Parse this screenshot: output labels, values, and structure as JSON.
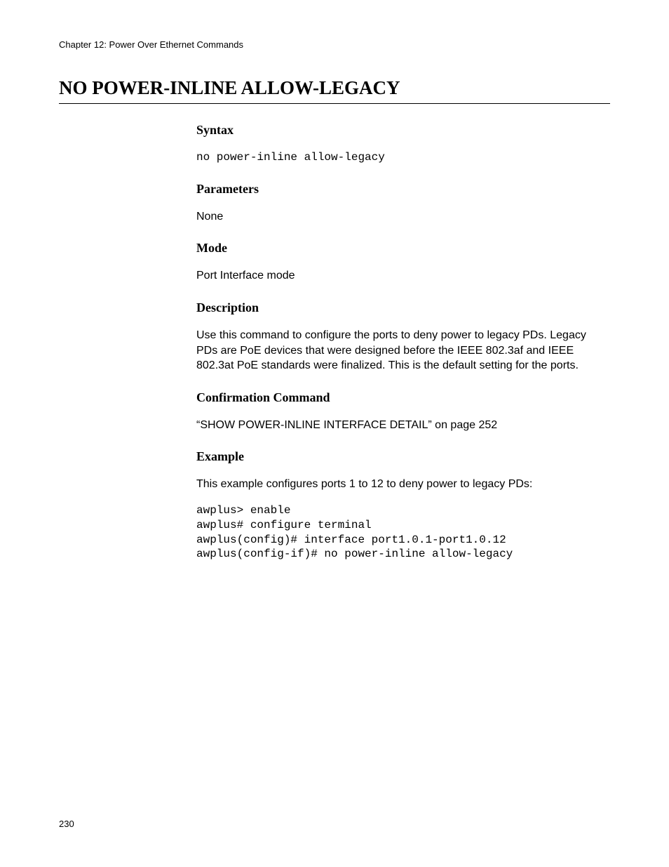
{
  "header": "Chapter 12: Power Over Ethernet Commands",
  "title": "NO POWER-INLINE ALLOW-LEGACY",
  "sections": {
    "syntax": {
      "heading": "Syntax",
      "code": "no power-inline allow-legacy"
    },
    "parameters": {
      "heading": "Parameters",
      "text": "None"
    },
    "mode": {
      "heading": "Mode",
      "text": "Port Interface mode"
    },
    "description": {
      "heading": "Description",
      "text": "Use this command to configure the ports to deny power to legacy PDs. Legacy PDs are PoE devices that were designed before the IEEE 802.3af and IEEE 802.3at PoE standards were finalized. This is the default setting for the ports."
    },
    "confirmation": {
      "heading": "Confirmation Command",
      "text": "“SHOW POWER-INLINE INTERFACE DETAIL” on page 252"
    },
    "example": {
      "heading": "Example",
      "intro": "This example configures ports 1 to 12 to deny power to legacy PDs:",
      "code": "awplus> enable\nawplus# configure terminal\nawplus(config)# interface port1.0.1-port1.0.12\nawplus(config-if)# no power-inline allow-legacy"
    }
  },
  "pageNumber": "230"
}
